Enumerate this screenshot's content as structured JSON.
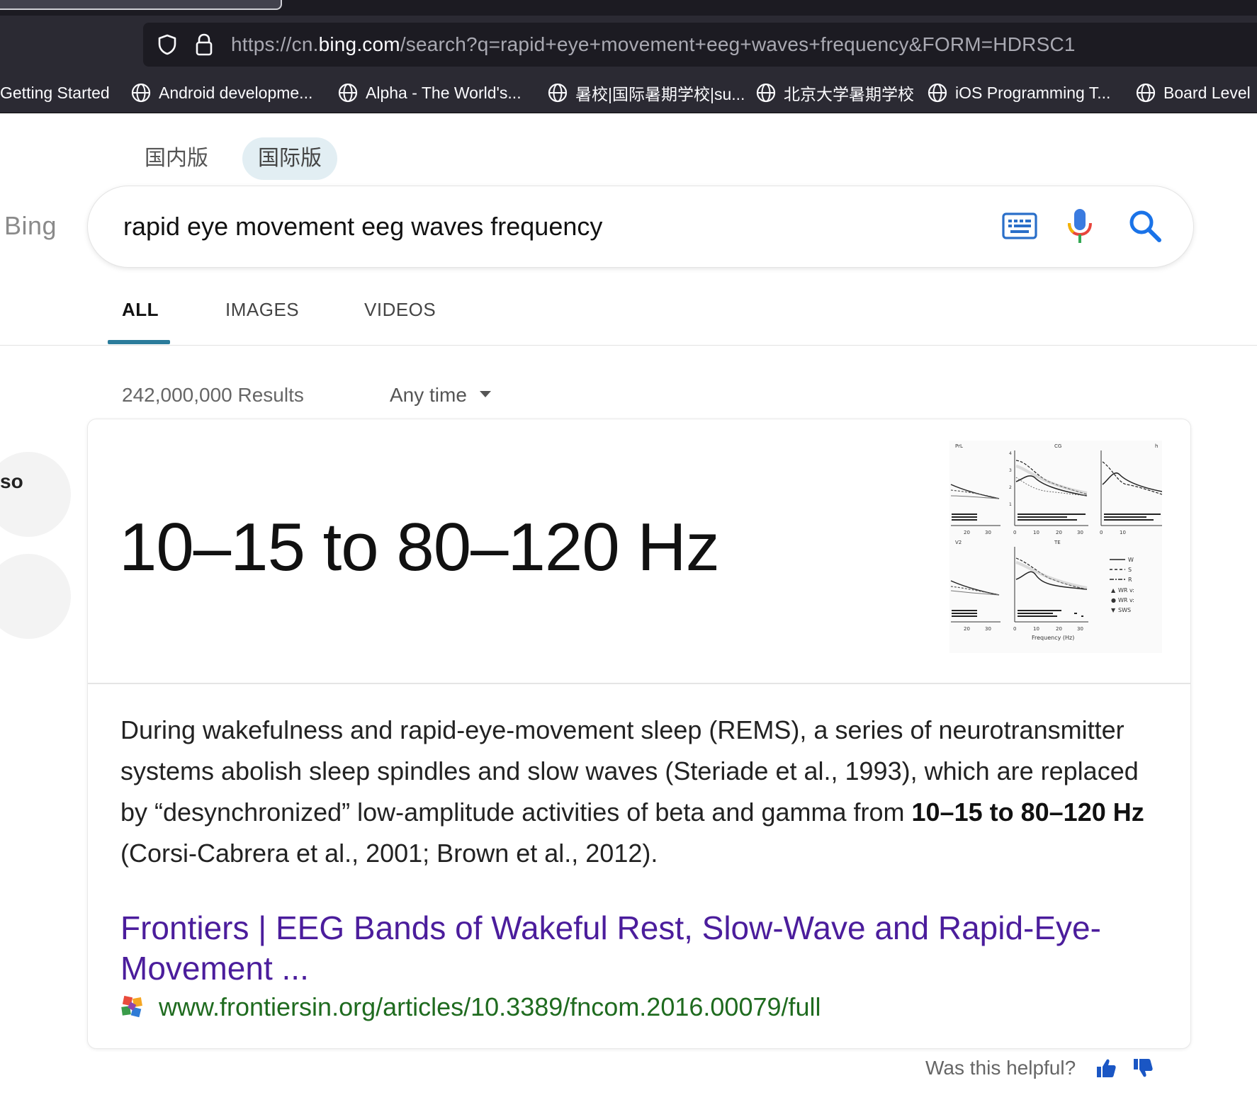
{
  "browser": {
    "url": {
      "prefix": "https://cn.",
      "host": "bing.com",
      "path": "/search?q=rapid+eye+movement+eeg+waves+frequency&FORM=HDRSC1"
    },
    "bookmarks": [
      {
        "label": "Getting Started"
      },
      {
        "label": "Android developme..."
      },
      {
        "label": "Alpha - The World's..."
      },
      {
        "label": "暑校|国际暑期学校|su..."
      },
      {
        "label": "北京大学暑期学校"
      },
      {
        "label": "iOS Programming T..."
      },
      {
        "label": "Board Level"
      }
    ]
  },
  "page": {
    "market_tabs": [
      {
        "label": "国内版",
        "selected": false
      },
      {
        "label": "国际版",
        "selected": true
      }
    ],
    "logo": "Bing",
    "search": {
      "query": "rapid eye movement eeg waves frequency"
    },
    "scopes": [
      {
        "label": "ALL",
        "active": true
      },
      {
        "label": "IMAGES",
        "active": false
      },
      {
        "label": "VIDEOS",
        "active": false
      }
    ],
    "results_count": "242,000,000 Results",
    "time_filter": "Any time",
    "rail_label": "so",
    "answer": {
      "value": "10–15 to 80–120 Hz",
      "snippet_before": "During wakefulness and rapid-eye-movement sleep (REMS), a series of neurotransmitter systems abolish sleep spindles and slow waves (Steriade et al., 1993), which are replaced by “desynchronized” low-amplitude activities of beta and gamma from ",
      "snippet_bold": "10–15 to 80–120 Hz",
      "snippet_after": " (Corsi-Cabrera et al., 2001; Brown et al., 2012).",
      "link_title": "Frontiers | EEG Bands of Wakeful Rest, Slow-Wave and Rapid-Eye-Movement ...",
      "source_url": "www.frontiersin.org/articles/10.3389/fncom.2016.00079/full",
      "figure": {
        "panel_titles": [
          "PrL",
          "CG",
          "h",
          "V2",
          "TE"
        ],
        "x_ticks_small": [
          "20",
          "30"
        ],
        "x_ticks_large": [
          "0",
          "10",
          "20",
          "30"
        ],
        "x_ticks_right": [
          "0",
          "10"
        ],
        "y_ticks": [
          "4",
          "3",
          "2",
          "1"
        ],
        "x_axis_label": "Frequency (Hz)",
        "legend": [
          "W",
          "S",
          "R",
          "WR v:",
          "WR v:",
          "SWS"
        ]
      }
    },
    "feedback": {
      "label": "Was this helpful?"
    }
  },
  "colors": {
    "chrome_bg": "#2b2a33",
    "urlbar_bg": "#1c1b22",
    "scope_underline": "#2b7c9b",
    "link": "#4b1d9c",
    "source_url": "#1f6b1f",
    "feedback_icon": "#1a56c4"
  }
}
